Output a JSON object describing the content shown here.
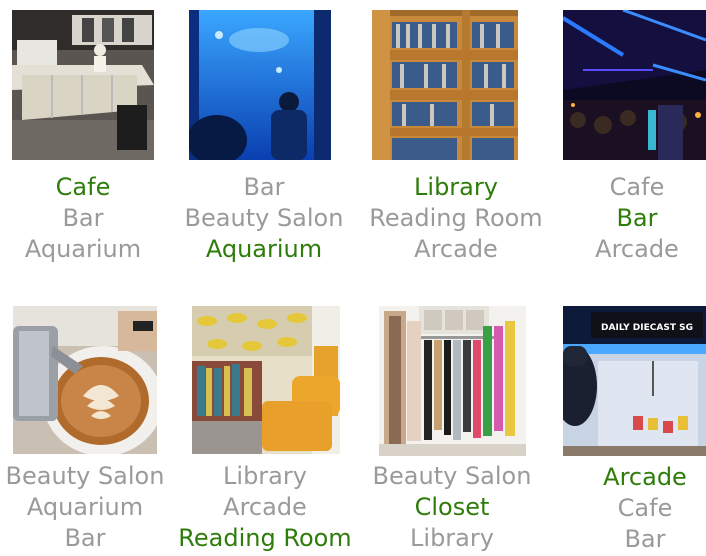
{
  "colors": {
    "correct": "#2e7d0b",
    "distractor": "#9a9a9a"
  },
  "examples": [
    {
      "image": "cafe-counter-photo",
      "options": [
        {
          "text": "Cafe",
          "correct": true
        },
        {
          "text": "Bar",
          "correct": false
        },
        {
          "text": "Aquarium",
          "correct": false
        }
      ]
    },
    {
      "image": "aquarium-tank-photo",
      "options": [
        {
          "text": "Bar",
          "correct": false
        },
        {
          "text": "Beauty Salon",
          "correct": false
        },
        {
          "text": "Aquarium",
          "correct": true
        }
      ]
    },
    {
      "image": "library-bookshelf-photo",
      "options": [
        {
          "text": "Library",
          "correct": true
        },
        {
          "text": "Reading Room",
          "correct": false
        },
        {
          "text": "Arcade",
          "correct": false
        }
      ]
    },
    {
      "image": "bar-interior-photo",
      "options": [
        {
          "text": "Cafe",
          "correct": false
        },
        {
          "text": "Bar",
          "correct": true
        },
        {
          "text": "Arcade",
          "correct": false
        }
      ]
    },
    {
      "image": "latte-art-photo",
      "options": [
        {
          "text": "Beauty Salon",
          "correct": false
        },
        {
          "text": "Aquarium",
          "correct": false
        },
        {
          "text": "Bar",
          "correct": false
        }
      ]
    },
    {
      "image": "reading-room-photo",
      "options": [
        {
          "text": "Library",
          "correct": false
        },
        {
          "text": "Arcade",
          "correct": false
        },
        {
          "text": "Reading Room",
          "correct": true
        }
      ]
    },
    {
      "image": "closet-clothes-photo",
      "options": [
        {
          "text": "Beauty Salon",
          "correct": false
        },
        {
          "text": "Closet",
          "correct": true
        },
        {
          "text": "Library",
          "correct": false
        }
      ]
    },
    {
      "image": "arcade-claw-machine-photo",
      "sign_text": "DAILY DIECAST SG",
      "options": [
        {
          "text": "Arcade",
          "correct": true
        },
        {
          "text": "Cafe",
          "correct": false
        },
        {
          "text": "Bar",
          "correct": false
        }
      ]
    }
  ]
}
